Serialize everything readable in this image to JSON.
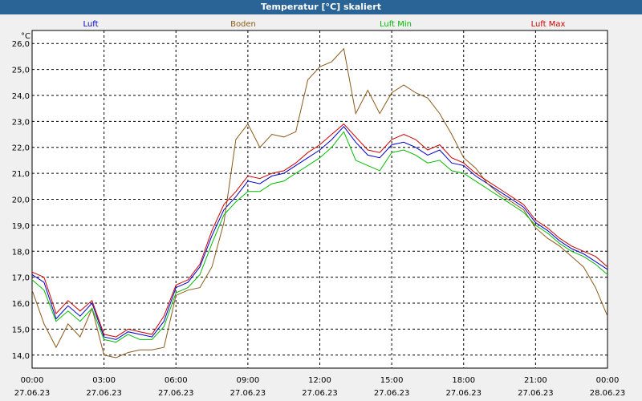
{
  "window": {
    "title": "Temperatur [°C] skaliert"
  },
  "colors": {
    "background": "#f0f0f0",
    "titlebar": "#2a6496"
  },
  "chart_data": {
    "type": "line",
    "title": "Temperatur [°C] skaliert",
    "ylabel": "°C",
    "xlabel": "",
    "ylim": [
      13.5,
      26.5
    ],
    "grid": true,
    "legend_position": "top",
    "y_ticks": [
      "14,0",
      "15,0",
      "16,0",
      "17,0",
      "18,0",
      "19,0",
      "20,0",
      "21,0",
      "22,0",
      "23,0",
      "24,0",
      "25,0",
      "26,0"
    ],
    "x_ticks": [
      {
        "time": "00:00",
        "date": "27.06.23"
      },
      {
        "time": "03:00",
        "date": "27.06.23"
      },
      {
        "time": "06:00",
        "date": "27.06.23"
      },
      {
        "time": "09:00",
        "date": "27.06.23"
      },
      {
        "time": "12:00",
        "date": "27.06.23"
      },
      {
        "time": "15:00",
        "date": "27.06.23"
      },
      {
        "time": "18:00",
        "date": "27.06.23"
      },
      {
        "time": "21:00",
        "date": "27.06.23"
      },
      {
        "time": "00:00",
        "date": "28.06.23"
      }
    ],
    "x": [
      "00:00",
      "00:30",
      "01:00",
      "01:30",
      "02:00",
      "02:30",
      "03:00",
      "03:30",
      "04:00",
      "04:30",
      "05:00",
      "05:30",
      "06:00",
      "06:30",
      "07:00",
      "07:30",
      "08:00",
      "08:30",
      "09:00",
      "09:30",
      "10:00",
      "10:30",
      "11:00",
      "11:30",
      "12:00",
      "12:30",
      "13:00",
      "13:30",
      "14:00",
      "14:30",
      "15:00",
      "15:30",
      "16:00",
      "16:30",
      "17:00",
      "17:30",
      "18:00",
      "18:30",
      "19:00",
      "19:30",
      "20:00",
      "20:30",
      "21:00",
      "21:30",
      "22:00",
      "22:30",
      "23:00",
      "23:30",
      "00:00"
    ],
    "series": [
      {
        "name": "Luft",
        "color": "#0000cc",
        "values": [
          17.1,
          16.8,
          15.4,
          15.9,
          15.5,
          16.0,
          14.7,
          14.6,
          14.9,
          14.8,
          14.7,
          15.3,
          16.6,
          16.8,
          17.4,
          18.6,
          19.6,
          20.1,
          20.7,
          20.6,
          20.9,
          21.0,
          21.3,
          21.6,
          21.9,
          22.3,
          22.8,
          22.2,
          21.7,
          21.6,
          22.1,
          22.2,
          22.0,
          21.7,
          21.9,
          21.4,
          21.3,
          20.9,
          20.6,
          20.3,
          20.0,
          19.7,
          19.1,
          18.8,
          18.4,
          18.1,
          17.9,
          17.6,
          17.3
        ]
      },
      {
        "name": "Boden",
        "color": "#8b5a1a",
        "values": [
          16.5,
          15.2,
          14.3,
          15.2,
          14.7,
          15.8,
          14.0,
          13.9,
          14.1,
          14.2,
          14.2,
          14.3,
          16.3,
          16.5,
          16.6,
          17.4,
          19.1,
          22.3,
          22.9,
          22.0,
          22.5,
          22.4,
          22.6,
          24.6,
          25.1,
          25.3,
          25.8,
          23.3,
          24.2,
          23.3,
          24.1,
          24.4,
          24.1,
          23.9,
          23.3,
          22.5,
          21.6,
          21.2,
          20.6,
          20.2,
          19.9,
          19.6,
          18.9,
          18.5,
          18.2,
          17.8,
          17.4,
          16.6,
          15.5
        ]
      },
      {
        "name": "Luft Min",
        "color": "#00bb00",
        "values": [
          16.9,
          16.5,
          15.3,
          15.7,
          15.3,
          15.8,
          14.6,
          14.5,
          14.8,
          14.6,
          14.6,
          15.1,
          16.4,
          16.6,
          17.1,
          18.3,
          19.4,
          19.9,
          20.3,
          20.3,
          20.6,
          20.7,
          21.0,
          21.3,
          21.6,
          22.0,
          22.6,
          21.5,
          21.3,
          21.1,
          21.8,
          21.9,
          21.7,
          21.4,
          21.5,
          21.1,
          21.0,
          20.7,
          20.4,
          20.1,
          19.8,
          19.5,
          19.0,
          18.7,
          18.3,
          18.0,
          17.8,
          17.5,
          17.1
        ]
      },
      {
        "name": "Luft Max",
        "color": "#cc0000",
        "values": [
          17.2,
          17.0,
          15.6,
          16.1,
          15.7,
          16.1,
          14.8,
          14.7,
          15.0,
          14.9,
          14.8,
          15.5,
          16.7,
          16.9,
          17.5,
          18.8,
          19.8,
          20.3,
          20.9,
          20.8,
          21.0,
          21.1,
          21.4,
          21.8,
          22.1,
          22.5,
          22.9,
          22.4,
          21.9,
          21.8,
          22.3,
          22.5,
          22.3,
          21.9,
          22.1,
          21.6,
          21.4,
          21.0,
          20.7,
          20.4,
          20.1,
          19.8,
          19.2,
          18.9,
          18.5,
          18.2,
          18.0,
          17.8,
          17.4
        ]
      }
    ]
  }
}
